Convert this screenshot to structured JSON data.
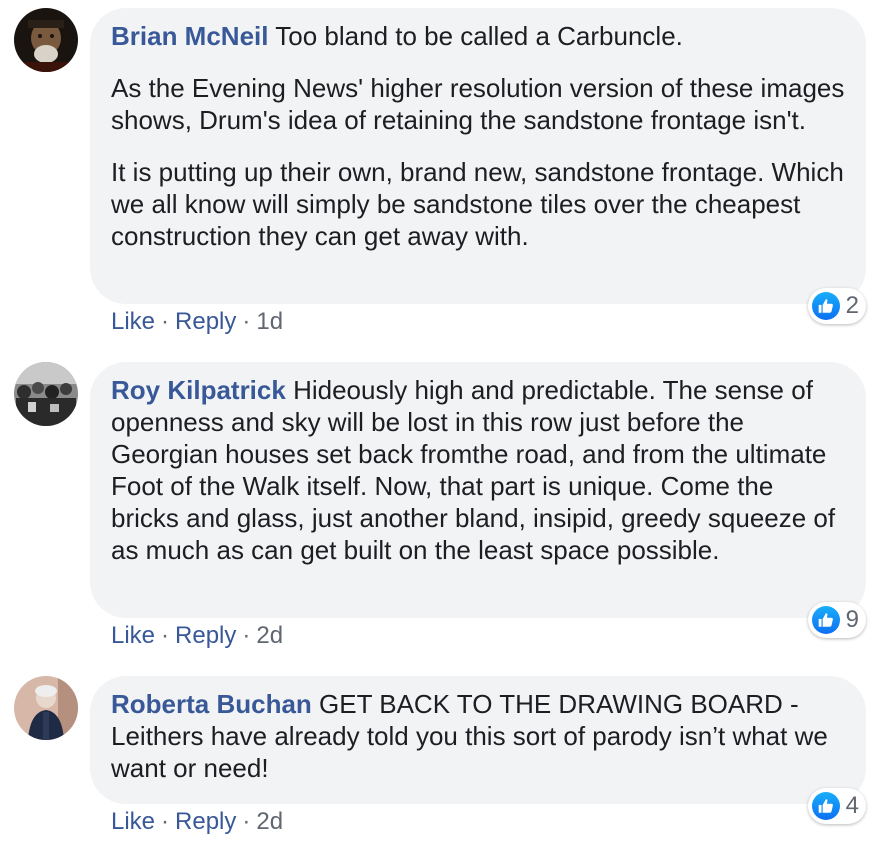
{
  "comments": [
    {
      "author": "Brian McNeil",
      "paragraphs": [
        "Too bland to be called a Carbuncle.",
        "As the Evening News' higher resolution version of these images shows, Drum's idea of retaining the sandstone frontage isn't.",
        "It is putting up their own, brand new, sandstone frontage. Which we all know will simply be sandstone tiles over the cheapest construction they can get away with."
      ],
      "reaction_count": "2",
      "like_label": "Like",
      "reply_label": "Reply",
      "time": "1d"
    },
    {
      "author": "Roy Kilpatrick",
      "paragraphs": [
        "Hideously high and predictable. The sense of openness and sky will be lost in this row just before the Georgian houses set back fromthe road, and from the ultimate Foot of the Walk itself. Now, that part is unique. Come the bricks and glass, just another bland, insipid, greedy squeeze of as much as can get built on the least space possible."
      ],
      "reaction_count": "9",
      "like_label": "Like",
      "reply_label": "Reply",
      "time": "2d"
    },
    {
      "author": "Roberta Buchan",
      "paragraphs": [
        "GET BACK TO THE DRAWING BOARD - Leithers have already told you this sort of parody isn’t what we want or need!"
      ],
      "reaction_count": "4",
      "like_label": "Like",
      "reply_label": "Reply",
      "time": "2d"
    }
  ],
  "separator": "·",
  "colors": {
    "author_link": "#385898",
    "bubble_bg": "#f2f3f5",
    "meta_text": "#606770",
    "like_badge": "#1877f2"
  },
  "icons": {
    "reaction": "thumbs-up-icon"
  }
}
